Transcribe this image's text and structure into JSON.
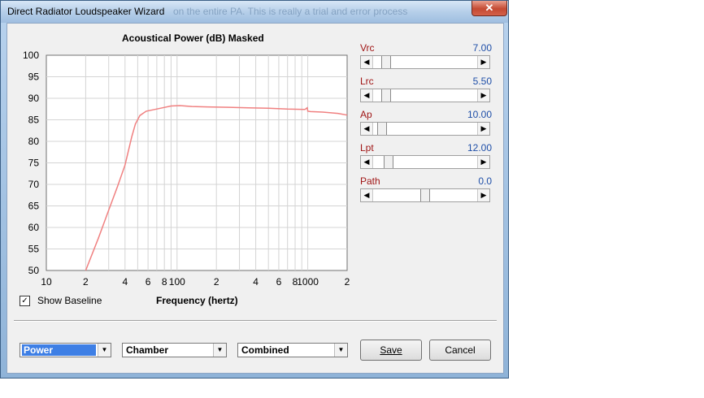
{
  "window": {
    "title": "Direct Radiator Loudspeaker Wizard",
    "background_text": "on the entire PA. This is really a trial and error process",
    "close_symbol": "✕"
  },
  "chart_data": {
    "type": "line",
    "title": "Acoustical Power (dB)   Masked",
    "xlabel": "Frequency (hertz)",
    "ylabel": "",
    "x_scale": "log",
    "xlim": [
      10,
      2000
    ],
    "ylim": [
      50,
      100
    ],
    "y_ticks": [
      50,
      55,
      60,
      65,
      70,
      75,
      80,
      85,
      90,
      95,
      100
    ],
    "x_tick_labels": [
      {
        "value": 10,
        "label": "10"
      },
      {
        "value": 20,
        "label": "2"
      },
      {
        "value": 40,
        "label": "4"
      },
      {
        "value": 60,
        "label": "6"
      },
      {
        "value": 80,
        "label": "8"
      },
      {
        "value": 100,
        "label": "100"
      },
      {
        "value": 200,
        "label": "2"
      },
      {
        "value": 400,
        "label": "4"
      },
      {
        "value": 600,
        "label": "6"
      },
      {
        "value": 800,
        "label": "8"
      },
      {
        "value": 1000,
        "label": "1000"
      },
      {
        "value": 2000,
        "label": "2"
      }
    ],
    "grid": true,
    "series": [
      {
        "color": "#f08080",
        "x": [
          20,
          25,
          30,
          35,
          40,
          45,
          48,
          52,
          58,
          65,
          75,
          90,
          105,
          130,
          170,
          250,
          350,
          500,
          700,
          950,
          990,
          1000,
          1050,
          1300,
          1700,
          2000
        ],
        "y": [
          50,
          57.5,
          64,
          69.5,
          74.5,
          81,
          84,
          86,
          87,
          87.3,
          87.7,
          88.2,
          88.3,
          88.1,
          88.0,
          87.9,
          87.8,
          87.7,
          87.5,
          87.4,
          87.8,
          87.0,
          86.9,
          86.8,
          86.5,
          86.1
        ]
      }
    ]
  },
  "params": [
    {
      "name": "Vrc",
      "value": "7.00",
      "position": 0.09
    },
    {
      "name": "Lrc",
      "value": "5.50",
      "position": 0.09
    },
    {
      "name": "Ap",
      "value": "10.00",
      "position": 0.05
    },
    {
      "name": "Lpt",
      "value": "12.00",
      "position": 0.12
    },
    {
      "name": "Path",
      "value": "0.0",
      "position": 0.5
    }
  ],
  "show_baseline": {
    "label": "Show Baseline",
    "checked": true,
    "check_mark": "✓"
  },
  "combos": [
    {
      "value": "Power",
      "selected": true
    },
    {
      "value": "Chamber",
      "selected": false
    },
    {
      "value": "Combined",
      "selected": false
    }
  ],
  "buttons": {
    "save": "Save",
    "cancel": "Cancel"
  },
  "icons": {
    "arrow_left": "◀",
    "arrow_right": "▶",
    "dropdown": "▼"
  }
}
